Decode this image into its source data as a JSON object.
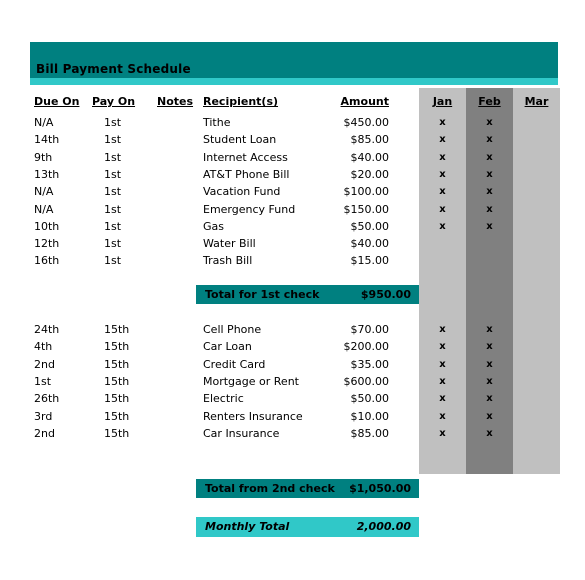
{
  "sheet": {
    "title": "Bill Payment Schedule",
    "colors": {
      "teal": "#008080",
      "cyan": "#30c8c8",
      "month_light": "#c0c0c0",
      "month_dark": "#808080",
      "text": "#000000"
    }
  },
  "columns": {
    "due_on": "Due On",
    "pay_on": "Pay On",
    "notes": "Notes",
    "recipients": "Recipient(s)",
    "amount": "Amount",
    "months": [
      "Jan",
      "Feb",
      "Mar"
    ]
  },
  "check_mark": "x",
  "sections": [
    {
      "id": "first-check",
      "rows": [
        {
          "due_on": "N/A",
          "pay_on": "1st",
          "notes": "",
          "recipient": "Tithe",
          "amount": "$450.00",
          "jan": "x",
          "feb": "x",
          "mar": ""
        },
        {
          "due_on": "14th",
          "pay_on": "1st",
          "notes": "",
          "recipient": "Student Loan",
          "amount": "$85.00",
          "jan": "x",
          "feb": "x",
          "mar": ""
        },
        {
          "due_on": "9th",
          "pay_on": "1st",
          "notes": "",
          "recipient": "Internet Access",
          "amount": "$40.00",
          "jan": "x",
          "feb": "x",
          "mar": ""
        },
        {
          "due_on": "13th",
          "pay_on": "1st",
          "notes": "",
          "recipient": "AT&T Phone Bill",
          "amount": "$20.00",
          "jan": "x",
          "feb": "x",
          "mar": ""
        },
        {
          "due_on": "N/A",
          "pay_on": "1st",
          "notes": "",
          "recipient": "Vacation Fund",
          "amount": "$100.00",
          "jan": "x",
          "feb": "x",
          "mar": ""
        },
        {
          "due_on": "N/A",
          "pay_on": "1st",
          "notes": "",
          "recipient": "Emergency Fund",
          "amount": "$150.00",
          "jan": "x",
          "feb": "x",
          "mar": ""
        },
        {
          "due_on": "10th",
          "pay_on": "1st",
          "notes": "",
          "recipient": "Gas",
          "amount": "$50.00",
          "jan": "x",
          "feb": "x",
          "mar": ""
        },
        {
          "due_on": "12th",
          "pay_on": "1st",
          "notes": "",
          "recipient": "Water Bill",
          "amount": "$40.00",
          "jan": "",
          "feb": "",
          "mar": ""
        },
        {
          "due_on": "16th",
          "pay_on": "1st",
          "notes": "",
          "recipient": "Trash Bill",
          "amount": "$15.00",
          "jan": "",
          "feb": "",
          "mar": ""
        }
      ],
      "total": {
        "label": "Total for 1st check",
        "value": "$950.00"
      }
    },
    {
      "id": "second-check",
      "rows": [
        {
          "due_on": "24th",
          "pay_on": "15th",
          "notes": "",
          "recipient": "Cell Phone",
          "amount": "$70.00",
          "jan": "x",
          "feb": "x",
          "mar": ""
        },
        {
          "due_on": "4th",
          "pay_on": "15th",
          "notes": "",
          "recipient": "Car Loan",
          "amount": "$200.00",
          "jan": "x",
          "feb": "x",
          "mar": ""
        },
        {
          "due_on": "2nd",
          "pay_on": "15th",
          "notes": "",
          "recipient": "Credit Card",
          "amount": "$35.00",
          "jan": "x",
          "feb": "x",
          "mar": ""
        },
        {
          "due_on": "1st",
          "pay_on": "15th",
          "notes": "",
          "recipient": "Mortgage or Rent",
          "amount": "$600.00",
          "jan": "x",
          "feb": "x",
          "mar": ""
        },
        {
          "due_on": "26th",
          "pay_on": "15th",
          "notes": "",
          "recipient": "Electric",
          "amount": "$50.00",
          "jan": "x",
          "feb": "x",
          "mar": ""
        },
        {
          "due_on": "3rd",
          "pay_on": "15th",
          "notes": "",
          "recipient": "Renters Insurance",
          "amount": "$10.00",
          "jan": "x",
          "feb": "x",
          "mar": ""
        },
        {
          "due_on": "2nd",
          "pay_on": "15th",
          "notes": "",
          "recipient": "Car Insurance",
          "amount": "$85.00",
          "jan": "x",
          "feb": "x",
          "mar": ""
        }
      ],
      "total": {
        "label": "Total from 2nd check",
        "value": "$1,050.00"
      }
    }
  ],
  "grand_total": {
    "label": "Monthly Total",
    "value": "2,000.00"
  }
}
